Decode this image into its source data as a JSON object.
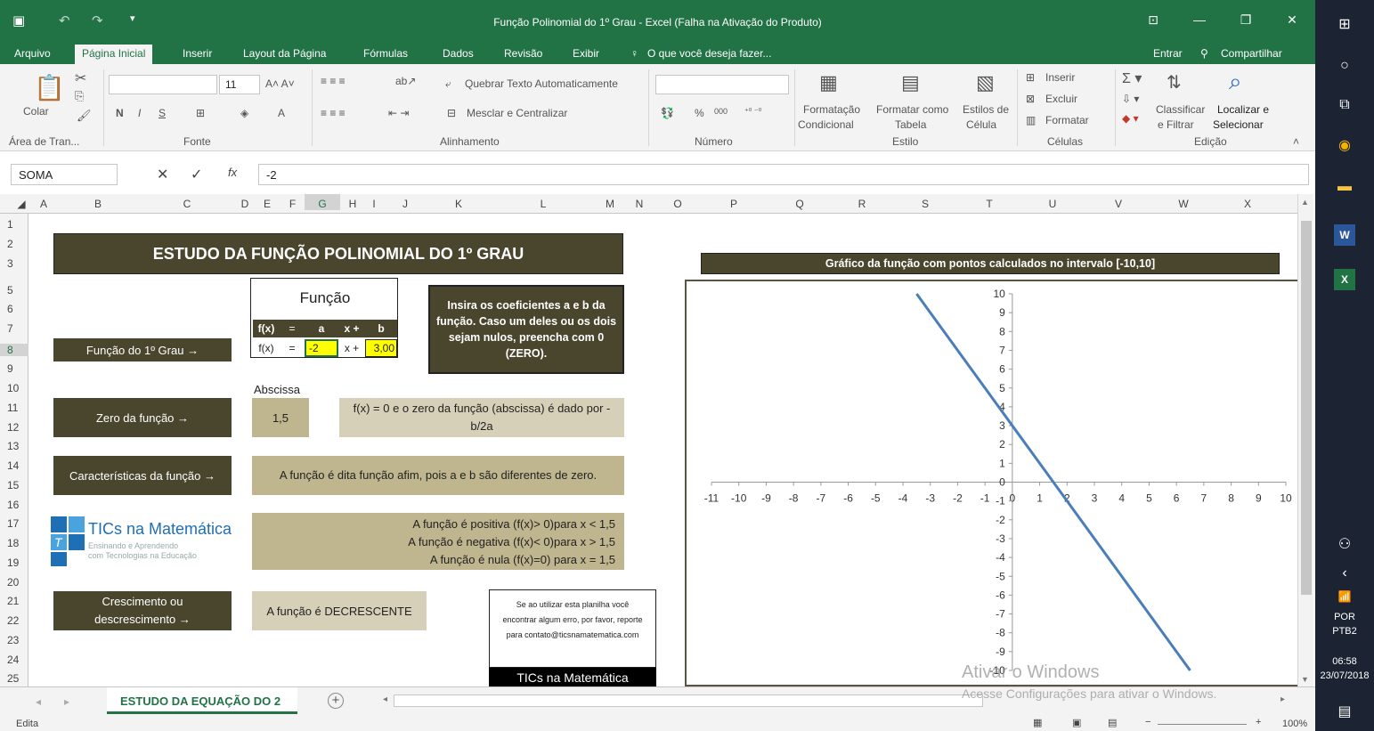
{
  "window": {
    "title": "Função Polinomial do 1º Grau - Excel (Falha na Ativação do Produto)"
  },
  "menu": {
    "items": [
      "Arquivo",
      "Página Inicial",
      "Inserir",
      "Layout da Página",
      "Fórmulas",
      "Dados",
      "Revisão",
      "Exibir"
    ],
    "tell_me": "O que você deseja fazer...",
    "sign_in": "Entrar",
    "share": "Compartilhar"
  },
  "ribbon": {
    "paste": "Colar",
    "font_size": "11",
    "wrap_text": "Quebrar Texto Automaticamente",
    "merge_center": "Mesclar e Centralizar",
    "percent": "%",
    "thousands": "000",
    "cond_format_1": "Formatação",
    "cond_format_2": "Condicional",
    "format_table_1": "Formatar como",
    "format_table_2": "Tabela",
    "cell_styles_1": "Estilos de",
    "cell_styles_2": "Célula",
    "insert": "Inserir",
    "delete": "Excluir",
    "format": "Formatar",
    "sort_filter_1": "Classificar",
    "sort_filter_2": "e Filtrar",
    "find_select_1": "Localizar e",
    "find_select_2": "Selecionar",
    "groups": [
      "Área de Tran...",
      "Fonte",
      "Alinhamento",
      "Número",
      "Estilo",
      "Células",
      "Edição"
    ]
  },
  "formula_bar": {
    "name_box": "SOMA",
    "fx": "fx",
    "value": "-2"
  },
  "columns": [
    "A",
    "B",
    "C",
    "D",
    "E",
    "F",
    "G",
    "H",
    "I",
    "J",
    "K",
    "L",
    "M",
    "N",
    "O",
    "P",
    "Q",
    "R",
    "S",
    "T",
    "U",
    "V",
    "W",
    "X"
  ],
  "rows": [
    "1",
    "2",
    "3",
    "5",
    "6",
    "7",
    "8",
    "9",
    "10",
    "11",
    "12",
    "13",
    "14",
    "15",
    "16",
    "17",
    "18",
    "19",
    "20",
    "21",
    "22",
    "23",
    "24",
    "25"
  ],
  "sheet": {
    "main_title": "ESTUDO DA FUNÇÃO POLINOMIAL DO 1º GRAU",
    "funcao_label": "Função",
    "fx_header": "f(x)",
    "eq_sign": "=",
    "a_header": "a",
    "x_plus": "x +",
    "b_header": "b",
    "fx_row": "f(x)",
    "a_value": "-2",
    "b_value": "3,00",
    "instructions": "Insira os coeficientes a e b da função. Caso um deles ou os dois sejam nulos, preencha com 0 (ZERO).",
    "func_1grau": "Função do 1º Grau →",
    "abscissa_label": "Abscissa",
    "zero_label": "Zero da função →",
    "zero_value": "1,5",
    "zero_desc": "f(x) = 0 e o zero da função (abscissa) é dado por - b/2a",
    "caracteristicas_label": "Características da função →",
    "caracteristicas_desc": "A função é dita função afim, pois a e b são diferentes de zero.",
    "sign_pos": "A função é positiva (f(x)> 0)para x <  1,5",
    "sign_neg": "A função é negativa (f(x)< 0)para x >  1,5",
    "sign_null": "A função é nula (f(x)=0) para x =   1,5",
    "logo_name": "TICs na Matemática",
    "logo_tagline_1": "Ensinando e Aprendendo",
    "logo_tagline_2": "com Tecnologias na Educação",
    "crescimento_label": "Crescimento ou descrescimento →",
    "crescimento_value": "A função é DECRESCENTE",
    "contact_text": "Se ao utilizar esta planilha você encontrar algum erro, por favor, reporte para contato@ticsnamatematica.com",
    "contact_footer": "TICs na Matemática",
    "chart_title": "Gráfico da função com pontos calculados no intervalo [-10,10]"
  },
  "chart_data": {
    "type": "line",
    "title": "Gráfico da função com pontos calculados no intervalo [-10,10]",
    "xlabel": "",
    "ylabel": "",
    "xlim": [
      -11,
      10
    ],
    "ylim": [
      -10,
      10
    ],
    "x_ticks": [
      "-11",
      "-10",
      "-9",
      "-8",
      "-7",
      "-6",
      "-5",
      "-4",
      "-3",
      "-2",
      "-1",
      "0",
      "1",
      "2",
      "3",
      "4",
      "5",
      "6",
      "7",
      "8",
      "9",
      "10"
    ],
    "y_ticks": [
      "-10",
      "-9",
      "-8",
      "-7",
      "-6",
      "-5",
      "-4",
      "-3",
      "-2",
      "-1",
      "0",
      "1",
      "2",
      "3",
      "4",
      "5",
      "6",
      "7",
      "8",
      "9",
      "10"
    ],
    "series": [
      {
        "x": [
          -3.5,
          6.5
        ],
        "y": [
          10,
          -10
        ],
        "color": "#4a7ebb"
      }
    ],
    "grid": false
  },
  "tabs": {
    "active": "ESTUDO DA EQUAÇÃO DO 2",
    "add": "+"
  },
  "status": {
    "mode": "Edita",
    "zoom": "100%"
  },
  "watermark": {
    "line1": "Ativar o Windows",
    "line2": "Acesse Configurações para ativar o Windows."
  },
  "taskbar": {
    "language_1": "POR",
    "language_2": "PTB2",
    "time": "06:58",
    "date": "23/07/2018"
  },
  "colors": {
    "excel_green": "#217346",
    "dark_olive": "#4a462e",
    "tan": "#d7d0b8",
    "tan_dark": "#bfb58f",
    "yellow": "#ffff00",
    "line_blue": "#4a7ebb"
  }
}
